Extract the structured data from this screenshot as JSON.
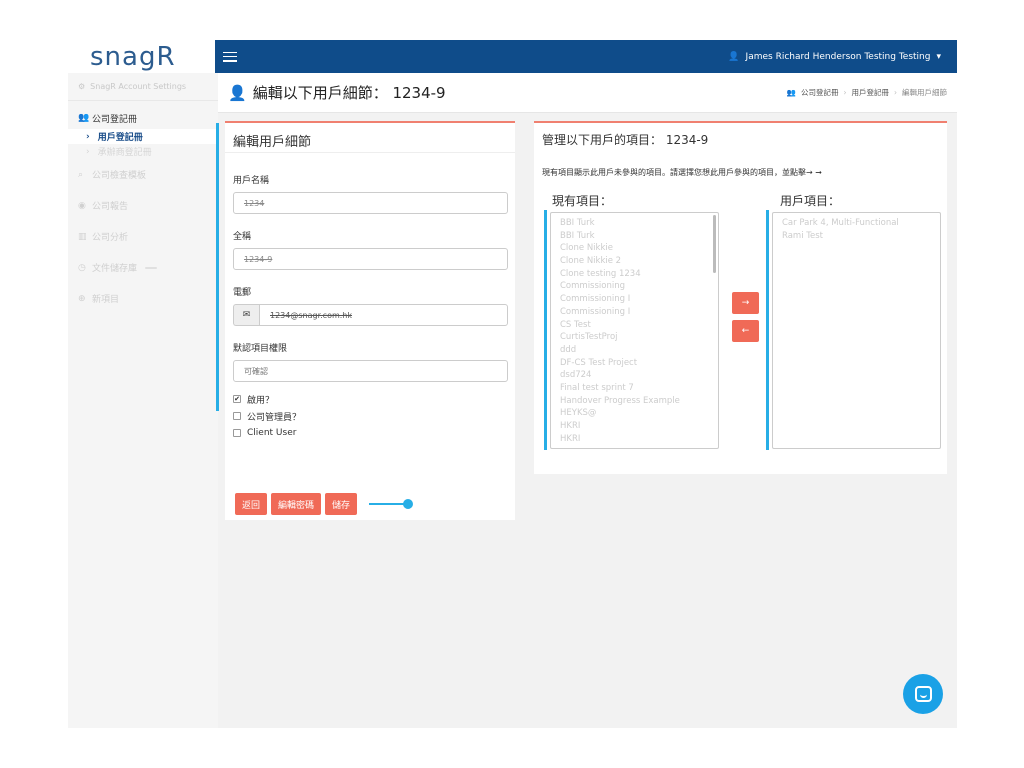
{
  "app": {
    "logo": "snagR"
  },
  "sidebar": {
    "settings_label": "SnagR Account Settings",
    "items": [
      {
        "label": "公司登記冊",
        "icon": "users-icon"
      },
      {
        "label": "用戶登記冊"
      },
      {
        "label": "承辦商登記冊"
      },
      {
        "label": "公司檢查模板",
        "icon": "search-icon"
      },
      {
        "label": "公司報告",
        "icon": "globe-icon"
      },
      {
        "label": "公司分析",
        "icon": "bar-chart-icon"
      },
      {
        "label": "文件儲存庫",
        "icon": "clock-icon",
        "badge": ""
      },
      {
        "label": "新項目",
        "icon": "plus-circle-icon"
      }
    ]
  },
  "topbar": {
    "user": "James Richard Henderson Testing Testing"
  },
  "header": {
    "title": "編輯以下用戶細節：  1234-9",
    "breadcrumb": [
      "公司登記冊",
      "用戶登記冊",
      "編輯用戶細節"
    ]
  },
  "form": {
    "title": "編輯用戶細節",
    "username_label": "用戶名稱",
    "username_value": "1234",
    "fullname_label": "全稱",
    "fullname_value": "1234-9",
    "email_label": "電郵",
    "email_value": "1234@snagr.com.hk",
    "permission_label": "默認項目權限",
    "permission_value": "可確認",
    "enabled_label": "啟用？",
    "enabled_checked": true,
    "admin_label": "公司管理員？",
    "admin_checked": false,
    "client_label": "Client User",
    "client_checked": false,
    "back_label": "返回",
    "password_label": "編輯密碼",
    "save_label": "儲存"
  },
  "projects": {
    "title": "管理以下用戶的項目：  1234-9",
    "hint": "現有項目顯示此用戶未參與的項目。請選擇您想此用戶參與的項目，並點擊→ ➞",
    "available_title": "現有項目：",
    "assigned_title": "用戶項目：",
    "available": [
      "BBI Turk",
      "BBI Turk",
      "Clone Nikkie",
      "Clone Nikkie 2",
      "Clone testing 1234",
      "Commissioning",
      "Commissioning I",
      "Commissioning I",
      "CS Test",
      "CurtisTestProj",
      "ddd",
      "DF-CS Test Project",
      "dsd724",
      "Final test sprint 7",
      "Handover Progress Example",
      "HEYKS@",
      "HKRI",
      "HKRI"
    ],
    "assigned": [
      "Car Park 4, Multi-Functional",
      "Rami Test"
    ],
    "add_label": "→",
    "remove_label": "←"
  }
}
